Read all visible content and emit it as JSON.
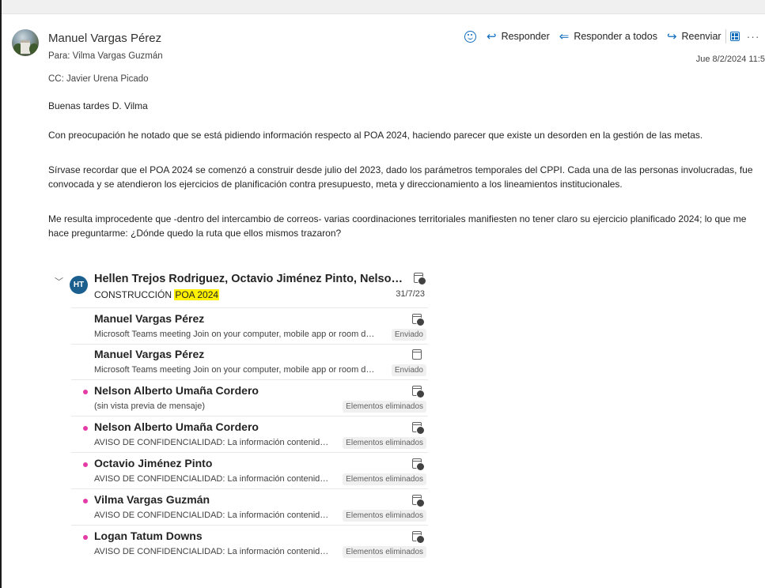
{
  "header": {
    "sender": "Manuel Vargas Pérez",
    "to": "Para: Vilma Vargas Guzmán",
    "cc": "CC: Javier Urena Picado",
    "date": "Jue 8/2/2024 11:5"
  },
  "actions": {
    "reply": "Responder",
    "reply_all": "Responder a todos",
    "forward": "Reenviar"
  },
  "body": {
    "greeting": "Buenas tardes D. Vilma",
    "p1": "Con preocupación he notado que se está pidiendo información respecto al POA 2024, haciendo parecer que existe un desorden en la gestión de las metas.",
    "p2": "Sírvase recordar que el POA 2024 se comenzó a construir desde julio del 2023, dado los parámetros temporales del CPPI. Cada una de las personas involucradas, fue convocada y se atendieron los ejercicios de planificación contra presupuesto, meta y direccionamiento a los lineamientos institucionales.",
    "p3": "Me resulta improcedente que -dentro del intercambio de correos- varias coordinaciones territoriales manifiesten no tener claro su ejercicio planificado 2024; lo que me hace preguntarme: ¿Dónde quedo la ruta que ellos mismos trazaron?"
  },
  "thread": {
    "initials": "HT",
    "participants": "Hellen Trejos Rodriguez, Octavio Jiménez Pinto, Nelson Alberto U...",
    "subject_prefix": "CONSTRUCCIÓN ",
    "subject_highlight": "POA 2024",
    "date": "31/7/23",
    "items": [
      {
        "name": "Manuel  Vargas Pérez",
        "preview": "Microsoft Teams meeting Join on your computer, mobile app or room device...",
        "tag": "Enviado"
      },
      {
        "name": "Manuel  Vargas Pérez",
        "preview": "Microsoft Teams meeting Join on your computer, mobile app or room device...",
        "tag": "Enviado"
      },
      {
        "name": "Nelson Alberto Umaña Cordero",
        "preview": "(sin vista previa de mensaje)",
        "tag": "Elementos eliminados"
      },
      {
        "name": "Nelson Alberto Umaña Cordero",
        "preview": "AVISO DE CONFIDENCIALIDAD: La información contenida en est...",
        "tag": "Elementos eliminados"
      },
      {
        "name": "Octavio Jiménez Pinto",
        "preview": "AVISO DE CONFIDENCIALIDAD: La información contenida en est...",
        "tag": "Elementos eliminados"
      },
      {
        "name": "Vilma Vargas Guzmán",
        "preview": "AVISO DE CONFIDENCIALIDAD: La información contenida en est...",
        "tag": "Elementos eliminados"
      },
      {
        "name": "Logan Tatum Downs",
        "preview": "AVISO DE CONFIDENCIALIDAD: La información contenida en est...",
        "tag": "Elementos eliminados"
      }
    ]
  }
}
